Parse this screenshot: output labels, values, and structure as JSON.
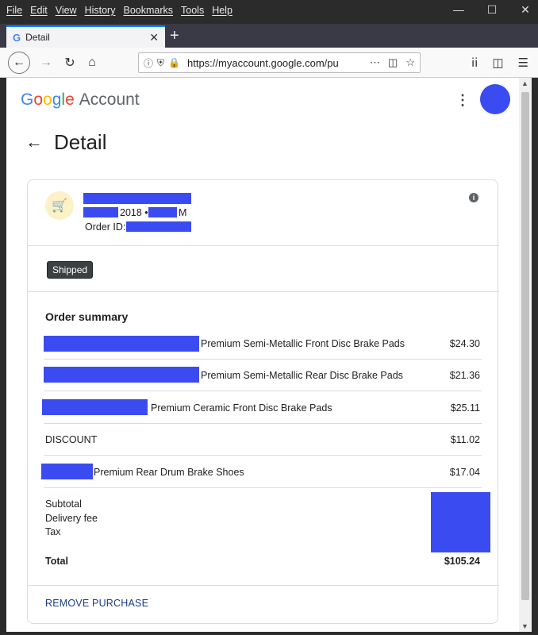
{
  "menubar": [
    "File",
    "Edit",
    "View",
    "History",
    "Bookmarks",
    "Tools",
    "Help"
  ],
  "tab": {
    "title": "Detail"
  },
  "urlbar": {
    "url": "https://myaccount.google.com/pu"
  },
  "header": {
    "brand_letters": [
      "G",
      "o",
      "o",
      "g",
      "l",
      "e"
    ],
    "account": "Account"
  },
  "page": {
    "title": "Detail"
  },
  "order": {
    "date_fragment": "2018 •",
    "time_suffix": "M",
    "order_id_label": "Order ID:",
    "status": "Shipped"
  },
  "summary": {
    "title": "Order summary",
    "items": [
      {
        "name": "Premium Semi-Metallic Front Disc Brake Pads",
        "price": "$24.30"
      },
      {
        "name": "Premium Semi-Metallic Rear Disc Brake Pads",
        "price": "$21.36"
      },
      {
        "name": "Premium Ceramic Front Disc Brake Pads",
        "price": "$25.11"
      },
      {
        "name": "DISCOUNT",
        "price": "$11.02"
      },
      {
        "name": "Premium Rear Drum Brake Shoes",
        "price": "$17.04"
      }
    ],
    "subtotal_label": "Subtotal",
    "delivery_label": "Delivery fee",
    "tax_label": "Tax",
    "total_label": "Total",
    "total_value": "$105.24"
  },
  "actions": {
    "remove": "REMOVE PURCHASE"
  },
  "colors": {
    "redaction": "#3b4bf2",
    "status_bg": "#3c4043",
    "link": "#1a3a8a"
  }
}
